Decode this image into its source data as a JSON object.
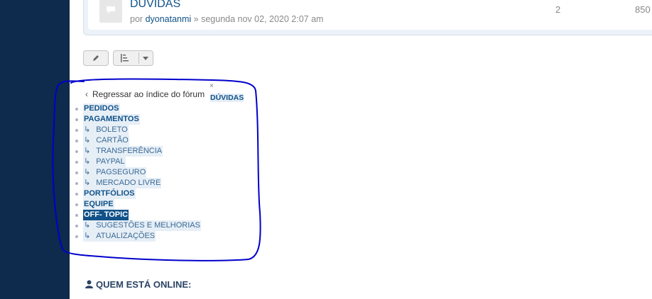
{
  "topic": {
    "title": "DÚVIDAS",
    "meta_prefix": "por",
    "author": "dyonatanmi",
    "meta_suffix": "» segunda nov 02, 2020 2:07 am",
    "replies": "2",
    "views": "850",
    "icon": "speech-bubble-icon"
  },
  "toolbar": {
    "edit_icon": "pencil-icon",
    "sort_icon": "sort-icon",
    "dropdown_icon": "caret-down-icon"
  },
  "jumpbox": {
    "back_label": "Regressar ao índice do fórum",
    "close_label": "×",
    "current_forum": "DÚVIDAS",
    "items": [
      {
        "prefix": "",
        "label": "PEDIDOS",
        "kind": "cat"
      },
      {
        "prefix": "",
        "label": "PAGAMENTOS",
        "kind": "cat"
      },
      {
        "prefix": "↳",
        "label": "BOLETO",
        "kind": "sub"
      },
      {
        "prefix": "↳",
        "label": "CARTÃO",
        "kind": "sub"
      },
      {
        "prefix": "↳",
        "label": "TRANSFERÊNCIA",
        "kind": "sub"
      },
      {
        "prefix": "↳",
        "label": "PAYPAL",
        "kind": "sub"
      },
      {
        "prefix": "↳",
        "label": "PAGSEGURO",
        "kind": "sub"
      },
      {
        "prefix": "↳",
        "label": "MERCADO LIVRE",
        "kind": "sub"
      },
      {
        "prefix": "",
        "label": "PORTFÓLIOS",
        "kind": "cat"
      },
      {
        "prefix": "",
        "label": "EQUIPE",
        "kind": "cat"
      },
      {
        "prefix": "",
        "label": "OFF- TOPIC",
        "kind": "selected"
      },
      {
        "prefix": "↳",
        "label": "SUGESTÕES E MELHORIAS",
        "kind": "sub"
      },
      {
        "prefix": "↳",
        "label": "ATUALIZAÇÕES",
        "kind": "sub"
      }
    ]
  },
  "online": {
    "heading": "QUEM ESTÁ ONLINE:",
    "icon": "user-icon",
    "annotation_color": "#0000cc"
  },
  "colors": {
    "sidebar": "#0e2a4c",
    "link": "#105289",
    "highlight": "#e6eef6",
    "annotation": "#0000cc"
  }
}
